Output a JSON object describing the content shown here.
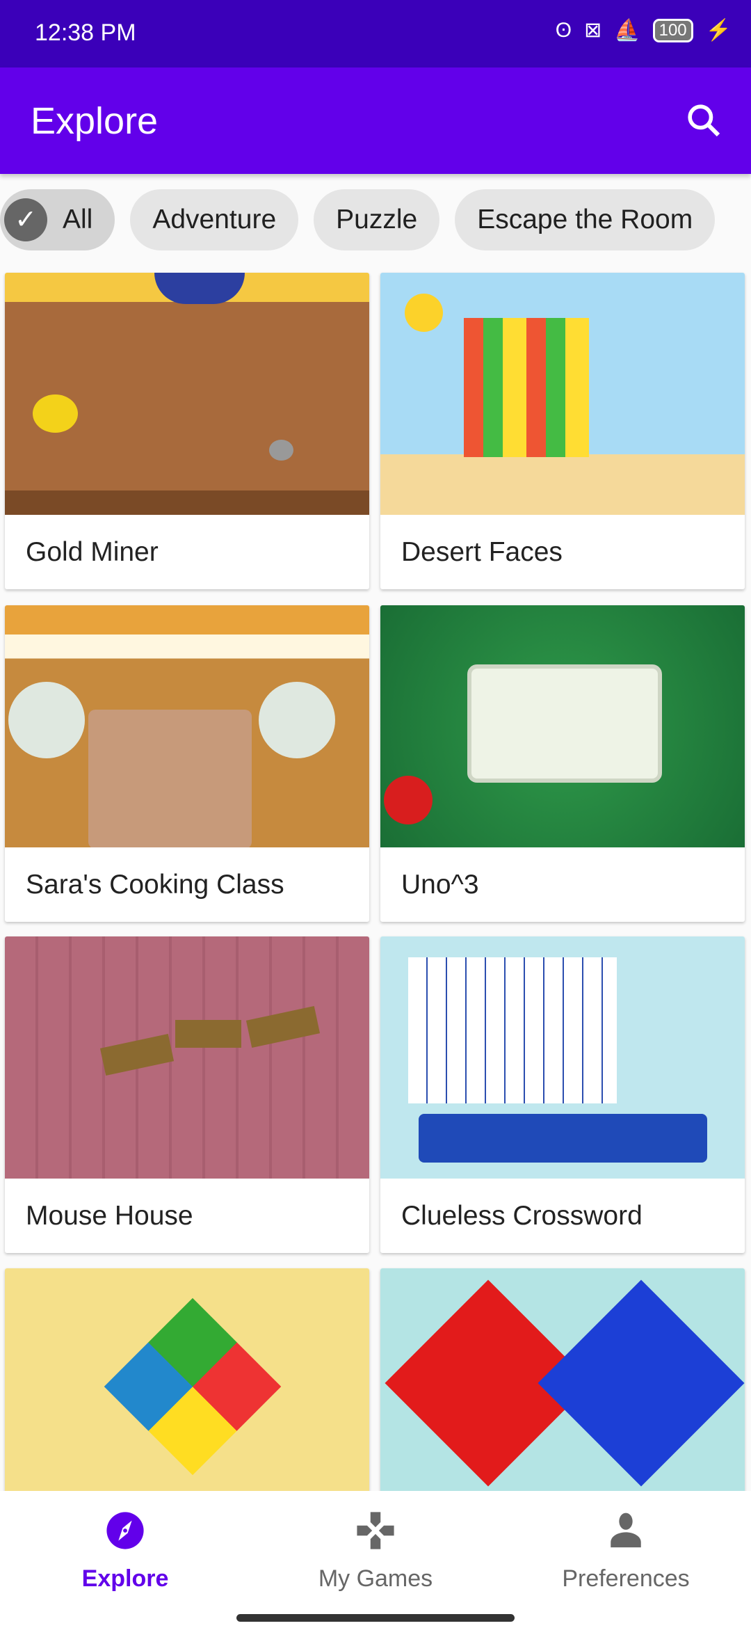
{
  "status_bar": {
    "time": "12:38 PM",
    "battery": "100"
  },
  "app_bar": {
    "title": "Explore",
    "search_icon": "search-icon"
  },
  "chips": [
    {
      "label": "All",
      "selected": true
    },
    {
      "label": "Adventure",
      "selected": false
    },
    {
      "label": "Puzzle",
      "selected": false
    },
    {
      "label": "Escape the Room",
      "selected": false
    }
  ],
  "games": [
    {
      "title": "Gold Miner"
    },
    {
      "title": "Desert Faces"
    },
    {
      "title": "Sara's Cooking Class"
    },
    {
      "title": "Uno^3"
    },
    {
      "title": "Mouse House"
    },
    {
      "title": "Clueless Crossword"
    },
    {
      "title": ""
    },
    {
      "title": ""
    }
  ],
  "bottom_nav": {
    "items": [
      {
        "label": "Explore",
        "icon": "compass-icon",
        "active": true
      },
      {
        "label": "My Games",
        "icon": "gamepad-icon",
        "active": false
      },
      {
        "label": "Preferences",
        "icon": "person-icon",
        "active": false
      }
    ]
  },
  "colors": {
    "primary": "#6200ea",
    "status_bar": "#3b00b9"
  }
}
